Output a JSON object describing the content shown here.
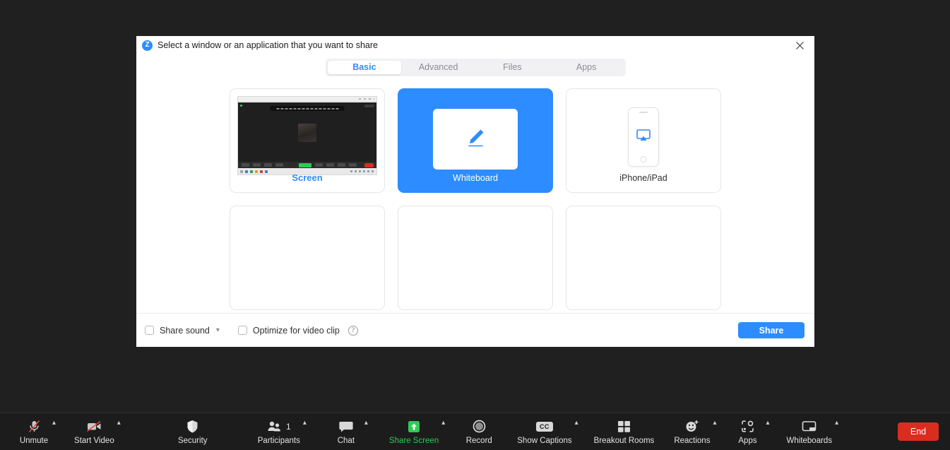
{
  "dialog": {
    "title": "Select a window or an application that you want to share",
    "logo_letter": "Z",
    "close_icon": "close-icon",
    "tabs": [
      {
        "label": "Basic",
        "active": true
      },
      {
        "label": "Advanced",
        "active": false
      },
      {
        "label": "Files",
        "active": false
      },
      {
        "label": "Apps",
        "active": false
      }
    ],
    "tiles": [
      {
        "label": "Screen",
        "icon": "screen-thumbnail",
        "selected": false
      },
      {
        "label": "Whiteboard",
        "icon": "pencil-icon",
        "selected": true
      },
      {
        "label": "iPhone/iPad",
        "icon": "airplay-icon",
        "selected": false
      }
    ],
    "footer": {
      "share_sound_label": "Share sound",
      "share_sound_checked": false,
      "share_sound_caret": "chevron-down-icon",
      "optimize_label": "Optimize for video clip",
      "optimize_checked": false,
      "help_label": "?",
      "share_button": "Share"
    }
  },
  "toolbar": {
    "items": [
      {
        "label": "Unmute",
        "icon": "microphone-muted-icon",
        "caret": true,
        "accent": "default"
      },
      {
        "label": "Start Video",
        "icon": "video-off-icon",
        "caret": true,
        "accent": "default"
      },
      {
        "label": "Security",
        "icon": "shield-icon",
        "caret": false,
        "accent": "default"
      },
      {
        "label": "Participants",
        "icon": "participants-icon",
        "caret": true,
        "accent": "default",
        "badge": "1"
      },
      {
        "label": "Chat",
        "icon": "chat-bubble-icon",
        "caret": true,
        "accent": "default"
      },
      {
        "label": "Share Screen",
        "icon": "share-screen-icon",
        "caret": true,
        "accent": "green"
      },
      {
        "label": "Record",
        "icon": "record-circle-icon",
        "caret": false,
        "accent": "default"
      },
      {
        "label": "Show Captions",
        "icon": "closed-captions-icon",
        "caret": true,
        "accent": "default",
        "badge_text": "CC"
      },
      {
        "label": "Breakout Rooms",
        "icon": "breakout-rooms-icon",
        "caret": false,
        "accent": "default"
      },
      {
        "label": "Reactions",
        "icon": "reactions-icon",
        "caret": true,
        "accent": "default"
      },
      {
        "label": "Apps",
        "icon": "apps-icon",
        "caret": true,
        "accent": "default"
      },
      {
        "label": "Whiteboards",
        "icon": "whiteboards-icon",
        "caret": true,
        "accent": "default"
      }
    ],
    "end_button": "End"
  },
  "colors": {
    "accent_blue": "#2d8cff",
    "green": "#2ecb53",
    "end_red": "#d92d20",
    "toolbar_bg": "#1c1c1c",
    "page_bg": "#202020"
  }
}
